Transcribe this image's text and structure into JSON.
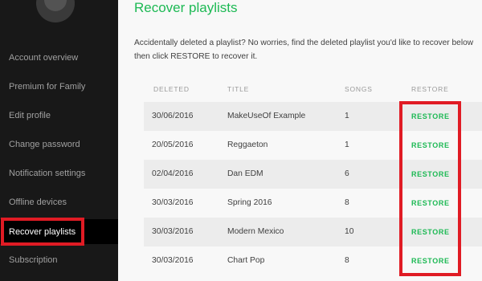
{
  "sidebar": {
    "items": [
      {
        "label": "Account overview"
      },
      {
        "label": "Premium for Family"
      },
      {
        "label": "Edit profile"
      },
      {
        "label": "Change password"
      },
      {
        "label": "Notification settings"
      },
      {
        "label": "Offline devices"
      },
      {
        "label": "Recover playlists"
      },
      {
        "label": "Subscription"
      }
    ],
    "active_index": 6
  },
  "main": {
    "title": "Recover playlists",
    "intro": "Accidentally deleted a playlist? No worries, find the deleted playlist you'd like to recover below then click RESTORE to recover it.",
    "columns": {
      "deleted": "DELETED",
      "title": "TITLE",
      "songs": "SONGS",
      "restore": "RESTORE"
    },
    "rows": [
      {
        "deleted": "30/06/2016",
        "title": "MakeUseOf Example",
        "songs": "1",
        "action": "RESTORE"
      },
      {
        "deleted": "20/05/2016",
        "title": "Reggaeton",
        "songs": "1",
        "action": "RESTORE"
      },
      {
        "deleted": "02/04/2016",
        "title": "Dan EDM",
        "songs": "6",
        "action": "RESTORE"
      },
      {
        "deleted": "30/03/2016",
        "title": "Spring 2016",
        "songs": "8",
        "action": "RESTORE"
      },
      {
        "deleted": "30/03/2016",
        "title": "Modern Mexico",
        "songs": "10",
        "action": "RESTORE"
      },
      {
        "deleted": "30/03/2016",
        "title": "Chart Pop",
        "songs": "8",
        "action": "RESTORE"
      }
    ]
  },
  "colors": {
    "accent": "#1db954",
    "sidebar_bg": "#181818",
    "highlight_box": "#e01b24"
  }
}
